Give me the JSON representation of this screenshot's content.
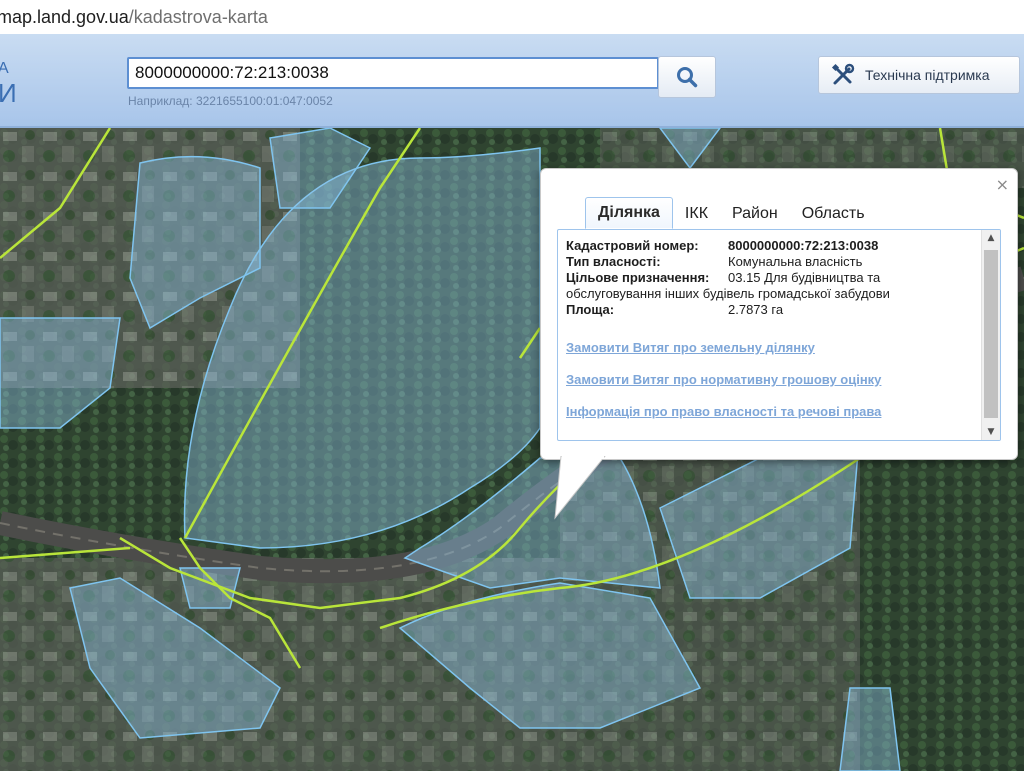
{
  "browser": {
    "url_host": "map.land.gov.ua",
    "url_path": "/kadastrova-karta"
  },
  "header": {
    "logo_line1": "А",
    "logo_line2": "И",
    "search_value": "8000000000:72:213:0038",
    "example_text": "Наприклад: 3221655100:01:047:0052",
    "support_label": "Технічна підтримка"
  },
  "popup": {
    "tabs": [
      "Ділянка",
      "ІКК",
      "Район",
      "Область"
    ],
    "active_tab": "Ділянка",
    "close_symbol": "×",
    "fields": {
      "cadastral_label": "Кадастровий номер:",
      "cadastral_value": "8000000000:72:213:0038",
      "ownership_label": "Тип власності:",
      "ownership_value": "Комунальна власність",
      "purpose_label": "Цільове призначення:",
      "purpose_value_line1": "03.15 Для будівництва та",
      "purpose_value_line2": "обслуговування інших будівель громадської забудови",
      "area_label": "Площа:",
      "area_value": "2.7873 га"
    },
    "links": [
      "Замовити Витяг про земельну ділянку",
      "Замовити Витяг про нормативну грошову оцінку",
      "Інформація про право власності та речові права"
    ]
  },
  "colors": {
    "parcel_fill": "#8fc3e8",
    "parcel_stroke": "#7fc4ef",
    "boundary_line": "#b9e53a",
    "link": "#7ea6d8",
    "tab_border": "#9ec4ec"
  }
}
